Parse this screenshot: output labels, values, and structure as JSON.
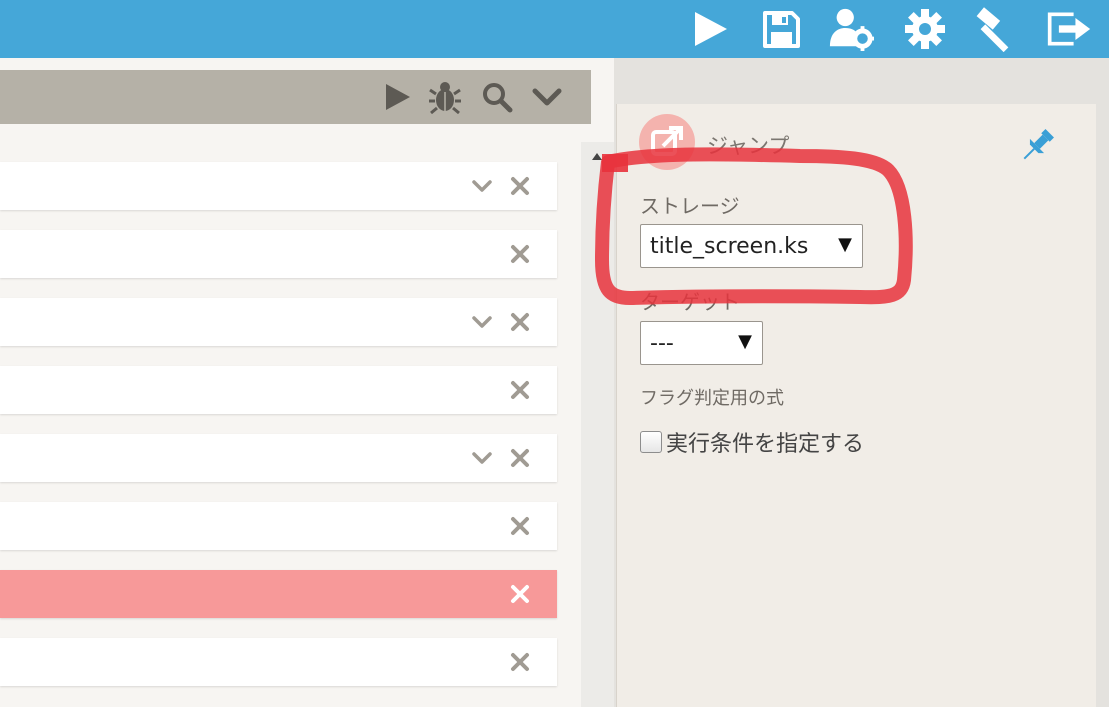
{
  "toolbar": {
    "icons": [
      "play-icon",
      "save-icon",
      "user-settings-icon",
      "gear-icon",
      "hammer-icon",
      "exit-icon"
    ]
  },
  "left_header": {
    "icons": [
      "play-icon",
      "bug-icon",
      "search-icon",
      "chevron-down-icon"
    ]
  },
  "rows": [
    {
      "has_chevron": true,
      "selected": false
    },
    {
      "has_chevron": false,
      "selected": false
    },
    {
      "has_chevron": true,
      "selected": false
    },
    {
      "has_chevron": false,
      "selected": false
    },
    {
      "has_chevron": true,
      "selected": false
    },
    {
      "has_chevron": false,
      "selected": false
    },
    {
      "has_chevron": false,
      "selected": true
    },
    {
      "has_chevron": false,
      "selected": false
    }
  ],
  "panel": {
    "title": "ジャンプ",
    "storage_label": "ストレージ",
    "storage_value": "title_screen.ks",
    "target_label": "ターゲット",
    "target_value": "---",
    "flag_label": "フラグ判定用の式",
    "condition_label": "実行条件を指定する",
    "condition_checked": false
  },
  "colors": {
    "toolbar": "#45a7d8",
    "selected_row": "#f79999",
    "annotation": "#e8323c",
    "pin": "#3a9fd6"
  }
}
